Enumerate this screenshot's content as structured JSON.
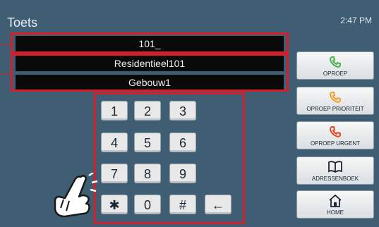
{
  "header": {
    "title": "Toets",
    "time": "2:47 PM"
  },
  "display": {
    "number": "101_",
    "name": "Residentieel101",
    "building": "Gebouw1"
  },
  "keypad": {
    "keys": [
      "1",
      "2",
      "3",
      "4",
      "5",
      "6",
      "7",
      "8",
      "9",
      "✱",
      "0",
      "#",
      "←"
    ]
  },
  "side_buttons": [
    {
      "label": "OPROEP",
      "icon": "phone-icon",
      "color": "#4caf50"
    },
    {
      "label": "OPROEP PRIORITEIT",
      "icon": "phone-icon",
      "color": "#f0a030"
    },
    {
      "label": "OPROEP URGENT",
      "icon": "phone-icon",
      "color": "#e04a2a"
    },
    {
      "label": "ADRESSENBOEK",
      "icon": "book-icon"
    },
    {
      "label": "HOME",
      "icon": "home-icon"
    }
  ],
  "colors": {
    "highlight": "#d41e2a",
    "background": "#3f5d73"
  }
}
